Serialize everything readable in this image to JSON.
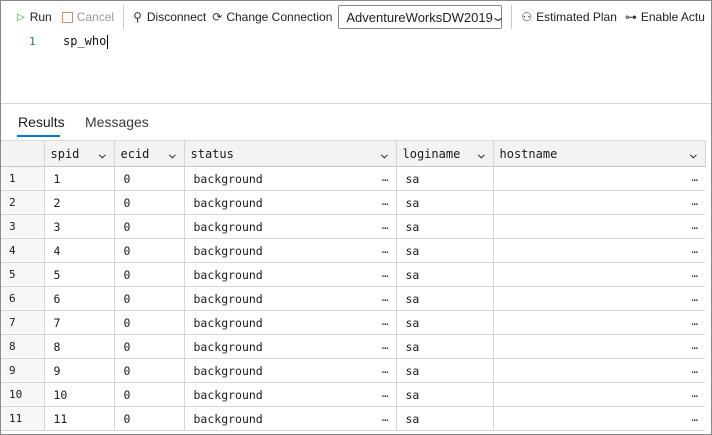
{
  "toolbar": {
    "run_label": "Run",
    "cancel_label": "Cancel",
    "disconnect_label": "Disconnect",
    "change_connection_label": "Change Connection",
    "database": "AdventureWorksDW2019",
    "estimated_plan_label": "Estimated Plan",
    "enable_actual_label": "Enable Actu"
  },
  "editor": {
    "line_number": "1",
    "code": "sp_who"
  },
  "results_tabs": [
    "Results",
    "Messages"
  ],
  "grid": {
    "columns": [
      "spid",
      "ecid",
      "status",
      "loginame",
      "hostname"
    ],
    "rows": [
      {
        "n": "1",
        "spid": "1",
        "ecid": "0",
        "status": "background",
        "loginame": "sa"
      },
      {
        "n": "2",
        "spid": "2",
        "ecid": "0",
        "status": "background",
        "loginame": "sa"
      },
      {
        "n": "3",
        "spid": "3",
        "ecid": "0",
        "status": "background",
        "loginame": "sa"
      },
      {
        "n": "4",
        "spid": "4",
        "ecid": "0",
        "status": "background",
        "loginame": "sa"
      },
      {
        "n": "5",
        "spid": "5",
        "ecid": "0",
        "status": "background",
        "loginame": "sa"
      },
      {
        "n": "6",
        "spid": "6",
        "ecid": "0",
        "status": "background",
        "loginame": "sa"
      },
      {
        "n": "7",
        "spid": "7",
        "ecid": "0",
        "status": "background",
        "loginame": "sa"
      },
      {
        "n": "8",
        "spid": "8",
        "ecid": "0",
        "status": "background",
        "loginame": "sa"
      },
      {
        "n": "9",
        "spid": "9",
        "ecid": "0",
        "status": "background",
        "loginame": "sa"
      },
      {
        "n": "10",
        "spid": "10",
        "ecid": "0",
        "status": "background",
        "loginame": "sa"
      },
      {
        "n": "11",
        "spid": "11",
        "ecid": "0",
        "status": "background",
        "loginame": "sa"
      }
    ],
    "truncated_marker": "…"
  },
  "colors": {
    "accent": "#0078d4",
    "run_green": "#3c9a3c",
    "line_number": "#237893"
  }
}
